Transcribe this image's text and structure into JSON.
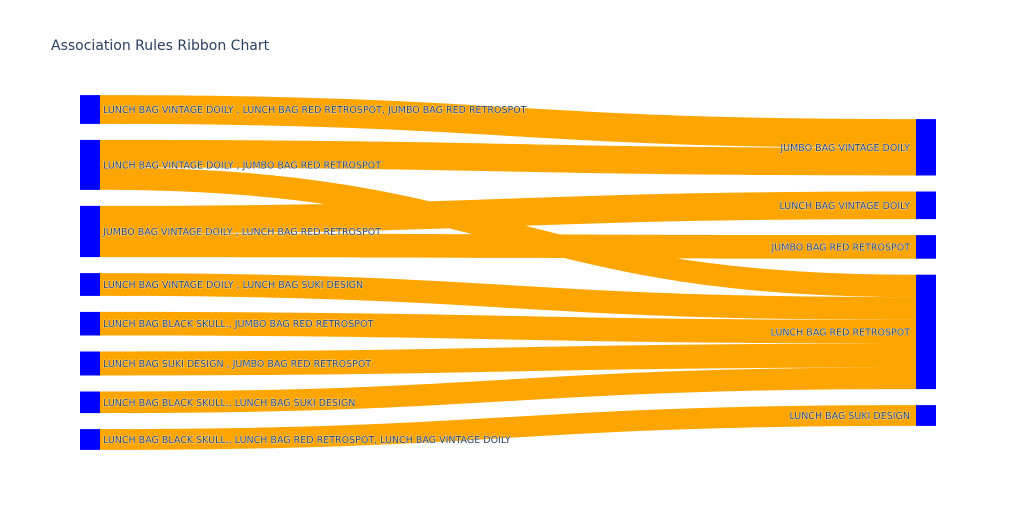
{
  "chart_data": {
    "type": "sankey",
    "title": "Association Rules Ribbon Chart",
    "colors": {
      "node": "#0000ff",
      "link": "#ffa500"
    },
    "sources": [
      "LUNCH BAG VINTAGE DOILY , LUNCH BAG RED RETROSPOT, JUMBO BAG RED RETROSPOT",
      "LUNCH BAG VINTAGE DOILY , JUMBO BAG RED RETROSPOT",
      "JUMBO BAG VINTAGE DOILY , LUNCH BAG RED RETROSPOT",
      "LUNCH BAG VINTAGE DOILY , LUNCH BAG SUKI DESIGN",
      "LUNCH BAG  BLACK SKULL., JUMBO BAG RED RETROSPOT",
      "LUNCH BAG SUKI DESIGN , JUMBO BAG RED RETROSPOT",
      "LUNCH BAG  BLACK SKULL., LUNCH BAG SUKI DESIGN",
      "LUNCH BAG  BLACK SKULL., LUNCH BAG RED RETROSPOT, LUNCH BAG VINTAGE DOILY"
    ],
    "targets": [
      "JUMBO BAG VINTAGE DOILY",
      "LUNCH BAG VINTAGE DOILY",
      "JUMBO BAG RED RETROSPOT",
      "LUNCH BAG RED RETROSPOT",
      "LUNCH BAG SUKI DESIGN"
    ],
    "links": [
      {
        "source": 0,
        "target": 0,
        "value": 1.44
      },
      {
        "source": 1,
        "target": 0,
        "value": 1.38
      },
      {
        "source": 1,
        "target": 3,
        "value": 1.12
      },
      {
        "source": 2,
        "target": 1,
        "value": 1.38
      },
      {
        "source": 2,
        "target": 2,
        "value": 1.18
      },
      {
        "source": 3,
        "target": 3,
        "value": 1.14
      },
      {
        "source": 4,
        "target": 3,
        "value": 1.18
      },
      {
        "source": 5,
        "target": 3,
        "value": 1.2
      },
      {
        "source": 6,
        "target": 3,
        "value": 1.08
      },
      {
        "source": 7,
        "target": 4,
        "value": 1.04
      }
    ]
  }
}
